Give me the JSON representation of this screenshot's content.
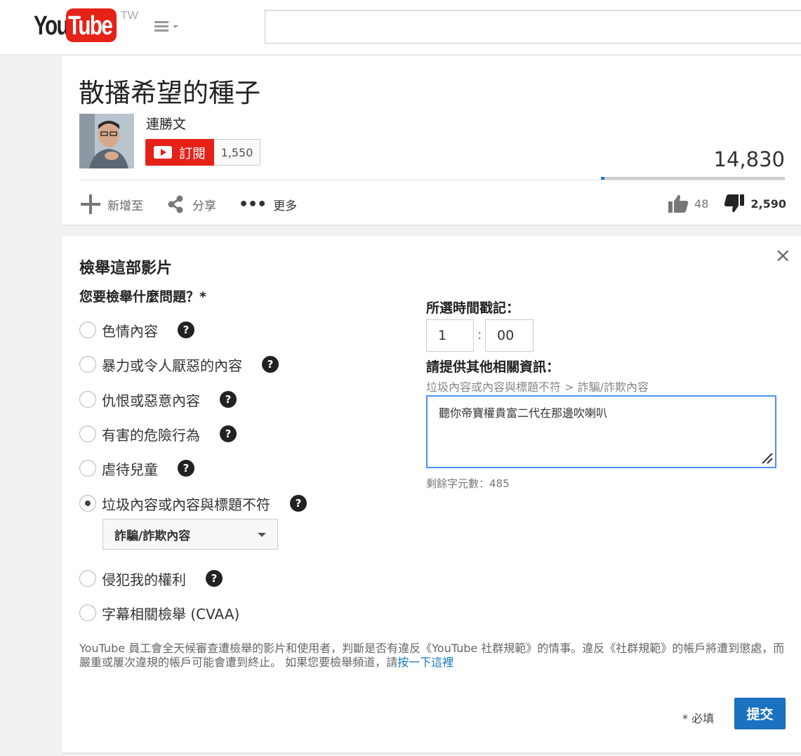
{
  "header": {
    "logo_you": "You",
    "logo_tube": "Tube",
    "region": "TW"
  },
  "video": {
    "title": "散播希望的種子",
    "channel_name": "連勝文",
    "subscribe_label": "訂閱",
    "subscriber_count": "1,550",
    "view_count": "14,830",
    "like_ratio": 0.018,
    "actions": {
      "add_to": "新增至",
      "share": "分享",
      "more": "更多"
    },
    "likes": "48",
    "dislikes": "2,590"
  },
  "report": {
    "title": "檢舉這部影片",
    "question": "您要檢舉什麼問題？*",
    "options": [
      "色情內容",
      "暴力或令人厭惡的內容",
      "仇恨或惡意內容",
      "有害的危險行為",
      "虐待兒童",
      "垃圾內容或內容與標題不符",
      "侵犯我的權利",
      "字幕相關檢舉 (CVAA)"
    ],
    "selected_option": "垃圾內容或內容與標題不符",
    "sub_reason": "詐騙/詐欺內容",
    "help_glyph": "?",
    "timestamp_label": "所選時間戳記：",
    "timestamp_min": "1",
    "timestamp_sep": ":",
    "timestamp_sec": "00",
    "details_label": "請提供其他相關資訊：",
    "breadcrumb": "垃圾內容或內容與標題不符 > 詐騙/詐欺內容",
    "details_value": "聽你帝寶權貴富二代在那邊吹喇叭",
    "chars_remaining": "剩餘字元數：485",
    "footer_text": "YouTube 員工會全天候審查遭檢舉的影片和使用者，判斷是否有違反《YouTube 社群規範》的情事。違反《社群規範》的帳戶將遭到懲處，而嚴重或屢次違規的帳戶可能會遭到終止。 如果您要檢舉頻道，請",
    "footer_link": "按一下這裡",
    "required_note": "* 必填",
    "submit_label": "提交",
    "close_glyph": "×"
  },
  "colors": {
    "brand_red": "#e62117",
    "accent_blue": "#167ac6",
    "submit_blue": "#1b72c0"
  }
}
